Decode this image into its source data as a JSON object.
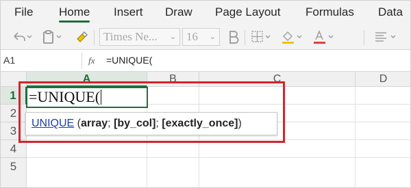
{
  "ribbon_tabs": [
    {
      "label": "File"
    },
    {
      "label": "Home",
      "active": true
    },
    {
      "label": "Insert"
    },
    {
      "label": "Draw"
    },
    {
      "label": "Page Layout"
    },
    {
      "label": "Formulas"
    },
    {
      "label": "Data"
    }
  ],
  "toolbar": {
    "font_name": "Times Ne...",
    "font_size": "16",
    "icons": [
      "undo-icon",
      "paste-icon",
      "format-painter-icon",
      "bold-icon",
      "borders-icon",
      "fill-color-icon",
      "font-color-icon",
      "align-icon"
    ],
    "accent_colors": {
      "fill": "#f2c200",
      "font": "#e0403a"
    }
  },
  "formula_bar": {
    "name_box": "A1",
    "fx_label": "fx",
    "formula": "=UNIQUE("
  },
  "grid": {
    "columns": [
      "A",
      "B",
      "C",
      "D"
    ],
    "rows": [
      "1",
      "2",
      "3",
      "4",
      "5"
    ],
    "selected_column": "A",
    "selected_row": "1",
    "active_cell_text": "=UNIQUE("
  },
  "tooltip": {
    "function_name": "UNIQUE",
    "open_paren": " (",
    "arg1": "array",
    "sep1": "; ",
    "arg2": "[by_col]",
    "sep2": "; ",
    "arg3": "[exactly_once]",
    "close_paren": ")"
  },
  "colors": {
    "accent_green": "#1e6e3c",
    "highlight_red": "#d6232b",
    "link_blue": "#1a3fa6"
  }
}
